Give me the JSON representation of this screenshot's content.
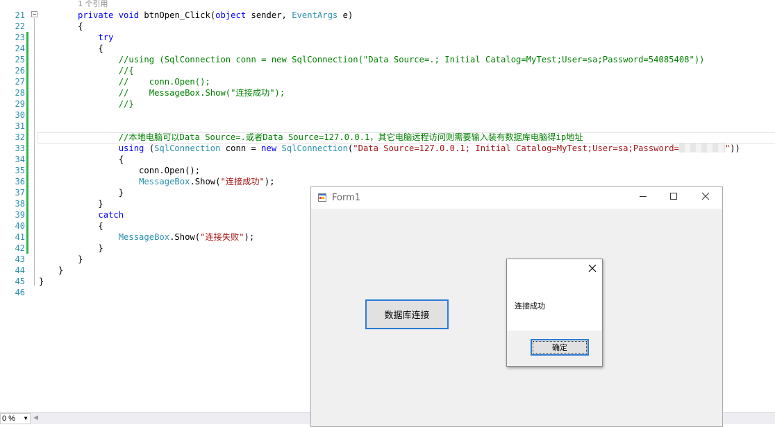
{
  "editor": {
    "ref_count": "1 个引用",
    "redacted_password_icon": "redacted-text",
    "lines": [
      {
        "n": "21",
        "parts": [
          {
            "k": "k",
            "t": "private"
          },
          {
            "t": " "
          },
          {
            "k": "k",
            "t": "void"
          },
          {
            "t": " btnOpen_Click("
          },
          {
            "k": "k",
            "t": "object"
          },
          {
            "t": " sender, "
          },
          {
            "k": "t",
            "t": "EventArgs"
          },
          {
            "t": " e)"
          }
        ]
      },
      {
        "n": "22",
        "parts": [
          {
            "t": "{"
          }
        ]
      },
      {
        "n": "23",
        "parts": [
          {
            "t": "    "
          },
          {
            "k": "k",
            "t": "try"
          }
        ]
      },
      {
        "n": "24",
        "parts": [
          {
            "t": "    {"
          }
        ]
      },
      {
        "n": "25",
        "parts": [
          {
            "t": "        "
          },
          {
            "k": "c",
            "t": "//using (SqlConnection conn = new SqlConnection(\"Data Source=.; Initial Catalog=MyTest;User=sa;Password=54085408\"))"
          }
        ]
      },
      {
        "n": "26",
        "parts": [
          {
            "t": "        "
          },
          {
            "k": "c",
            "t": "//{"
          }
        ]
      },
      {
        "n": "27",
        "parts": [
          {
            "t": "        "
          },
          {
            "k": "c",
            "t": "//    conn.Open();"
          }
        ]
      },
      {
        "n": "28",
        "parts": [
          {
            "t": "        "
          },
          {
            "k": "c",
            "t": "//    MessageBox.Show(\"连接成功\");"
          }
        ]
      },
      {
        "n": "29",
        "parts": [
          {
            "t": "        "
          },
          {
            "k": "c",
            "t": "//}"
          }
        ]
      },
      {
        "n": "30",
        "parts": []
      },
      {
        "n": "31",
        "parts": []
      },
      {
        "n": "32",
        "parts": [
          {
            "t": "        "
          },
          {
            "k": "c",
            "t": "//本地电脑可以Data Source=.或者Data Source=127.0.0.1，其它电脑远程访问则需要输入装有数据库电脑得ip地址"
          }
        ]
      },
      {
        "n": "33",
        "parts": [
          {
            "t": "        "
          },
          {
            "k": "k",
            "t": "using"
          },
          {
            "t": " ("
          },
          {
            "k": "t",
            "t": "SqlConnection"
          },
          {
            "t": " conn = "
          },
          {
            "k": "k",
            "t": "new"
          },
          {
            "t": " "
          },
          {
            "k": "t",
            "t": "SqlConnection"
          },
          {
            "t": "("
          },
          {
            "k": "s",
            "t": "\"Data Source=127.0.0.1; Initial Catalog=MyTest;User=sa;Password="
          },
          {
            "k": "redact",
            "t": ""
          },
          {
            "k": "s",
            "t": "\""
          },
          {
            "t": "))"
          }
        ]
      },
      {
        "n": "34",
        "parts": [
          {
            "t": "        {"
          }
        ]
      },
      {
        "n": "35",
        "parts": [
          {
            "t": "            conn.Open();"
          }
        ]
      },
      {
        "n": "36",
        "parts": [
          {
            "t": "            "
          },
          {
            "k": "t",
            "t": "MessageBox"
          },
          {
            "t": ".Show("
          },
          {
            "k": "s",
            "t": "\"连接成功\""
          },
          {
            "t": ");"
          }
        ]
      },
      {
        "n": "37",
        "parts": [
          {
            "t": "        }"
          }
        ]
      },
      {
        "n": "38",
        "parts": [
          {
            "t": "    }"
          }
        ]
      },
      {
        "n": "39",
        "parts": [
          {
            "t": "    "
          },
          {
            "k": "k",
            "t": "catch"
          }
        ]
      },
      {
        "n": "40",
        "parts": [
          {
            "t": "    {"
          }
        ]
      },
      {
        "n": "41",
        "parts": [
          {
            "t": "        "
          },
          {
            "k": "t",
            "t": "MessageBox"
          },
          {
            "t": ".Show("
          },
          {
            "k": "s",
            "t": "\"连接失败\""
          },
          {
            "t": ");"
          }
        ]
      },
      {
        "n": "42",
        "parts": [
          {
            "t": "    }"
          }
        ]
      },
      {
        "n": "43",
        "parts": [
          {
            "t": "}"
          }
        ]
      },
      {
        "n": "44",
        "parts": [
          {
            "t": "}"
          }
        ]
      },
      {
        "n": "45",
        "parts": [
          {
            "t": "}"
          }
        ]
      },
      {
        "n": "46",
        "parts": []
      }
    ]
  },
  "statusbar": {
    "zoom": "0 %"
  },
  "form": {
    "title": "Form1",
    "minimize_icon": "minimize-icon",
    "maximize_icon": "maximize-icon",
    "close_icon": "close-icon",
    "button_label": "数据库连接"
  },
  "messagebox": {
    "text": "连接成功",
    "ok_label": "确定",
    "close_icon": "close-icon"
  },
  "colors": {
    "keyword": "#0000ff",
    "type": "#2b91af",
    "string": "#a31515",
    "comment": "#008000",
    "accent": "#2a7bd5"
  }
}
